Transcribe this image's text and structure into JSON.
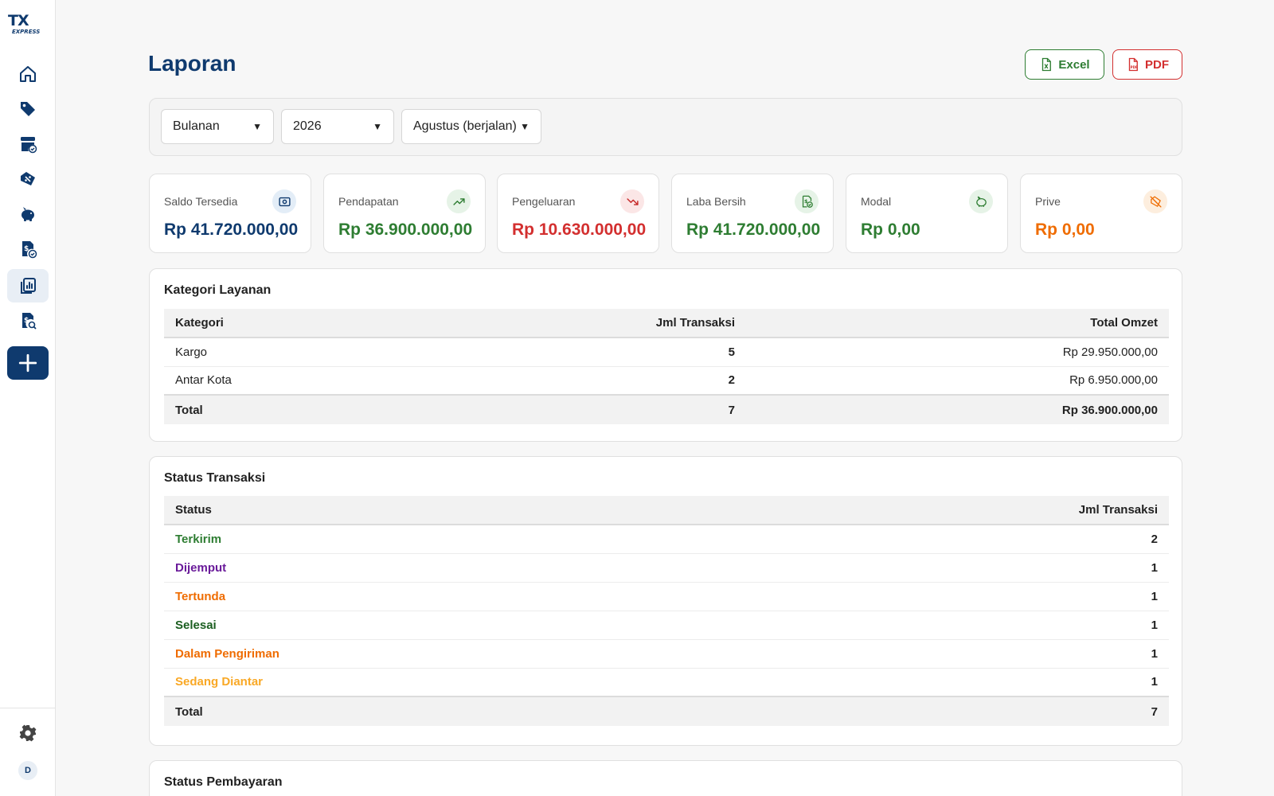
{
  "app": {
    "logo_main": "TX",
    "logo_sub": "EXPRESS",
    "avatar_initial": "D"
  },
  "page": {
    "title": "Laporan",
    "export_excel": "Excel",
    "export_pdf": "PDF"
  },
  "filters": {
    "period": "Bulanan",
    "year": "2026",
    "month": "Agustus (berjalan)"
  },
  "summary": [
    {
      "label": "Saldo Tersedia",
      "value": "Rp 41.720.000,00",
      "color": "#0f3a6e",
      "icon": "wallet-icon",
      "icon_bg": "#e3edf7"
    },
    {
      "label": "Pendapatan",
      "value": "Rp 36.900.000,00",
      "color": "#2e7d32",
      "icon": "trend-up-icon",
      "icon_bg": "#e6f3e7"
    },
    {
      "label": "Pengeluaran",
      "value": "Rp 10.630.000,00",
      "color": "#d32f2f",
      "icon": "trend-down-icon",
      "icon_bg": "#fbe6e6"
    },
    {
      "label": "Laba Bersih",
      "value": "Rp 41.720.000,00",
      "color": "#2e7d32",
      "icon": "money-check-icon",
      "icon_bg": "#e6f3e7"
    },
    {
      "label": "Modal",
      "value": "Rp 0,00",
      "color": "#2e7d32",
      "icon": "piggy-bank-icon",
      "icon_bg": "#e6f3e7"
    },
    {
      "label": "Prive",
      "value": "Rp 0,00",
      "color": "#ef6c00",
      "icon": "hand-money-icon",
      "icon_bg": "#fdeede"
    }
  ],
  "kategori": {
    "title": "Kategori Layanan",
    "headers": [
      "Kategori",
      "Jml Transaksi",
      "Total Omzet"
    ],
    "rows": [
      {
        "name": "Kargo",
        "count": "5",
        "omzet": "Rp 29.950.000,00"
      },
      {
        "name": "Antar Kota",
        "count": "2",
        "omzet": "Rp 6.950.000,00"
      }
    ],
    "total": {
      "name": "Total",
      "count": "7",
      "omzet": "Rp 36.900.000,00"
    }
  },
  "status": {
    "title": "Status Transaksi",
    "headers": [
      "Status",
      "Jml Transaksi"
    ],
    "rows": [
      {
        "name": "Terkirim",
        "count": "2",
        "color": "#2e7d32"
      },
      {
        "name": "Dijemput",
        "count": "1",
        "color": "#6a1b9a"
      },
      {
        "name": "Tertunda",
        "count": "1",
        "color": "#ef6c00"
      },
      {
        "name": "Selesai",
        "count": "1",
        "color": "#1b5e20"
      },
      {
        "name": "Dalam Pengiriman",
        "count": "1",
        "color": "#ef6c00"
      },
      {
        "name": "Sedang Diantar",
        "count": "1",
        "color": "#f9a825"
      }
    ],
    "total": {
      "name": "Total",
      "count": "7"
    }
  },
  "pembayaran": {
    "title": "Status Pembayaran"
  }
}
